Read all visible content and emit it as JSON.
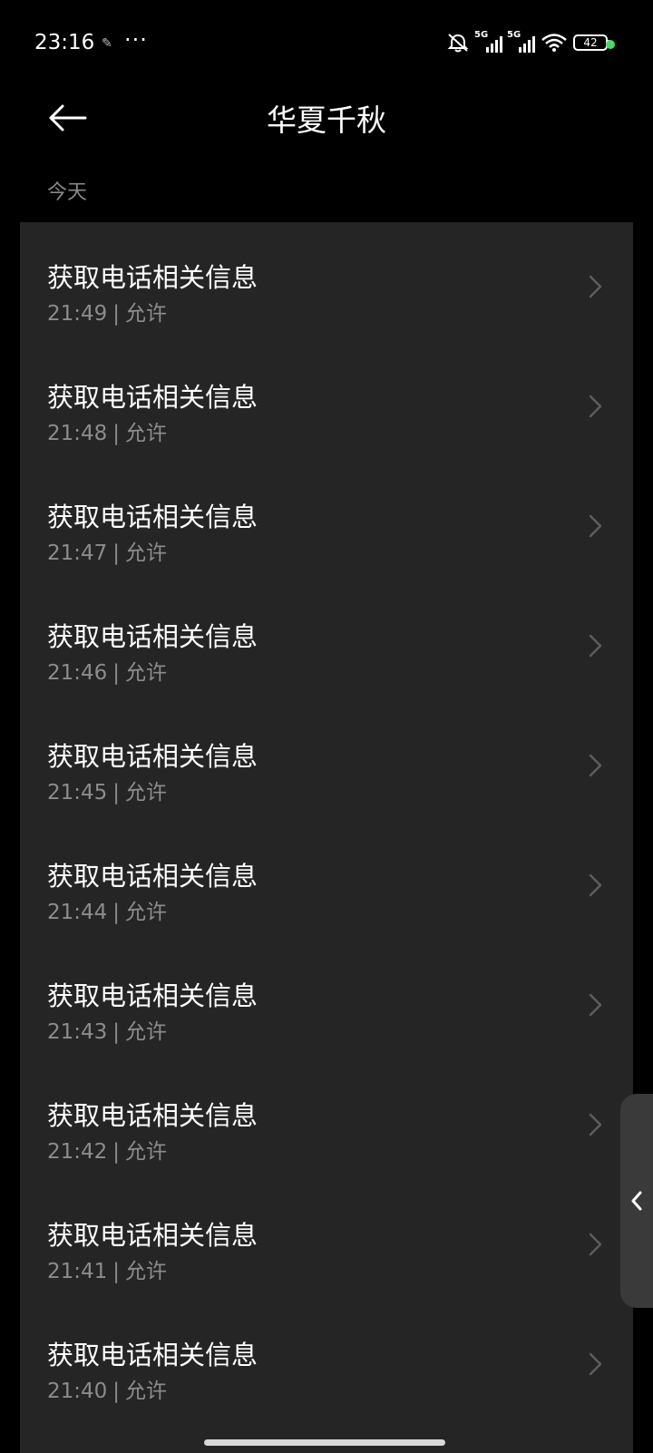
{
  "status_bar": {
    "time": "23:16",
    "network_label_1": "5G",
    "network_label_2": "5G",
    "battery": "42"
  },
  "header": {
    "title": "华夏千秋",
    "back_icon": "arrow-left-icon"
  },
  "section": {
    "label": "今天"
  },
  "records": [
    {
      "title": "获取电话相关信息",
      "time": "21:49",
      "status": "允许"
    },
    {
      "title": "获取电话相关信息",
      "time": "21:48",
      "status": "允许"
    },
    {
      "title": "获取电话相关信息",
      "time": "21:47",
      "status": "允许"
    },
    {
      "title": "获取电话相关信息",
      "time": "21:46",
      "status": "允许"
    },
    {
      "title": "获取电话相关信息",
      "time": "21:45",
      "status": "允许"
    },
    {
      "title": "获取电话相关信息",
      "time": "21:44",
      "status": "允许"
    },
    {
      "title": "获取电话相关信息",
      "time": "21:43",
      "status": "允许"
    },
    {
      "title": "获取电话相关信息",
      "time": "21:42",
      "status": "允许"
    },
    {
      "title": "获取电话相关信息",
      "time": "21:41",
      "status": "允许"
    },
    {
      "title": "获取电话相关信息",
      "time": "21:40",
      "status": "允许"
    }
  ],
  "colors": {
    "background": "#000000",
    "card": "#252525",
    "secondary_text": "#8c8c8c",
    "status_dot": "#4cd964"
  }
}
